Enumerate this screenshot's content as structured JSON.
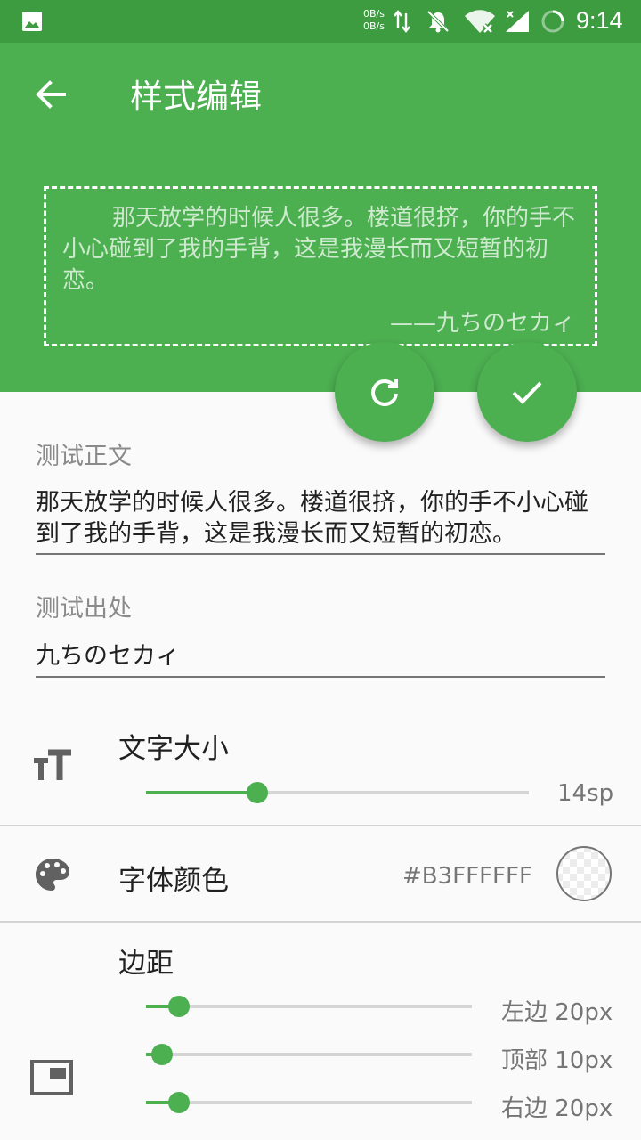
{
  "status_bar": {
    "speed_up": "0B/s",
    "speed_down": "0B/s",
    "time": "9:14"
  },
  "app_bar": {
    "title": "样式编辑",
    "back_icon": "arrow-back-icon"
  },
  "preview": {
    "text": "那天放学的时候人很多。楼道很挤，你的手不小心碰到了我的手背，这是我漫长而又短暂的初恋。",
    "source": "——九ちのセカィ"
  },
  "fabs": {
    "reset_icon": "refresh-icon",
    "confirm_icon": "check-icon"
  },
  "form": {
    "body_label": "测试正文",
    "body_value": "那天放学的时候人很多。楼道很挤，你的手不小心碰到了我的手背，这是我漫长而又短暂的初恋。",
    "source_label": "测试出处",
    "source_value": "九ちのセカィ"
  },
  "font_size": {
    "title": "文字大小",
    "value": "14sp",
    "level": 0.29,
    "icon": "text-size-icon"
  },
  "font_color": {
    "title": "字体颜色",
    "value": "#B3FFFFFF",
    "icon": "palette-icon"
  },
  "margins": {
    "title": "边距",
    "icon": "picture-in-picture-icon",
    "items": [
      {
        "label": "左边 20px",
        "level": 0.1
      },
      {
        "label": "顶部 10px",
        "level": 0.05
      },
      {
        "label": "右边 20px",
        "level": 0.1
      }
    ]
  },
  "colors": {
    "primary": "#4caf50",
    "status_bar": "#3d9b40"
  }
}
